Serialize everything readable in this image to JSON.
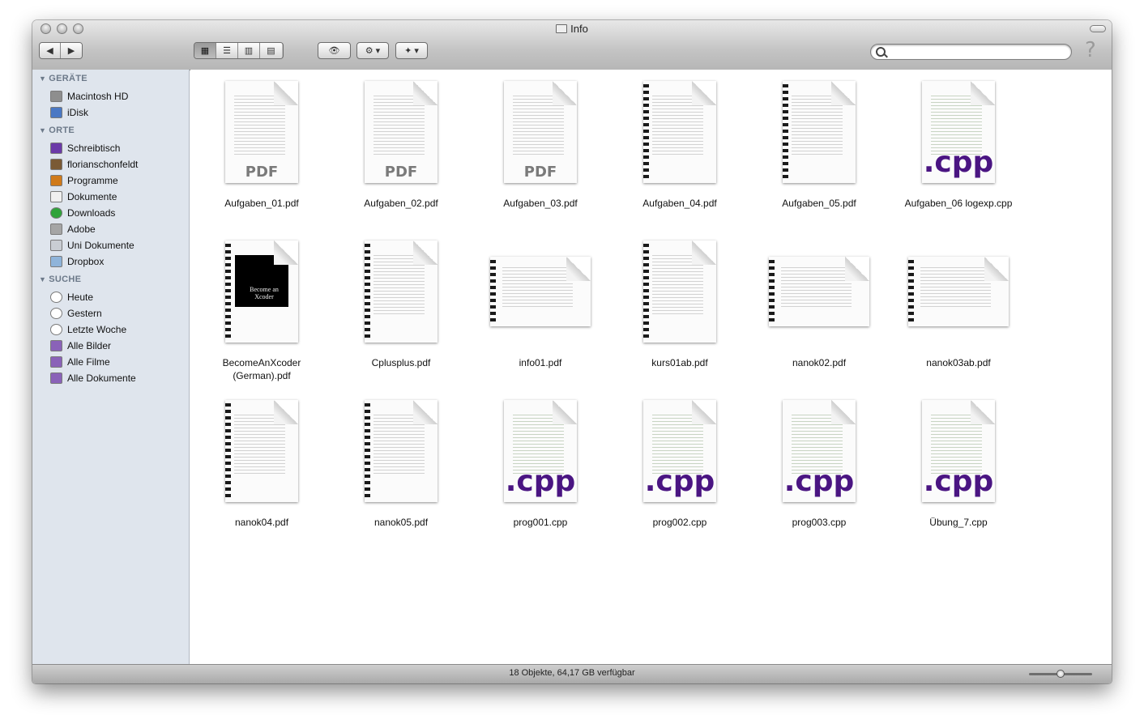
{
  "window": {
    "title": "Info"
  },
  "toolbar": {
    "back": "◀",
    "forward": "▶",
    "views": [
      {
        "name": "icon-view",
        "glyph": "▦",
        "active": true
      },
      {
        "name": "list-view",
        "glyph": "☰",
        "active": false
      },
      {
        "name": "column-view",
        "glyph": "▥",
        "active": false
      },
      {
        "name": "coverflow-view",
        "glyph": "▤",
        "active": false
      }
    ],
    "quicklook": "👁",
    "action": "⚙ ▾",
    "dropbox": "✦ ▾",
    "search_placeholder": "",
    "help": "?"
  },
  "sidebar": {
    "sections": [
      {
        "label": "GERÄTE",
        "items": [
          {
            "label": "Macintosh HD",
            "icon": "harddisk-icon",
            "color": "#8e8e8e"
          },
          {
            "label": "iDisk",
            "icon": "idisk-icon",
            "color": "#4a78c4"
          }
        ]
      },
      {
        "label": "ORTE",
        "items": [
          {
            "label": "Schreibtisch",
            "icon": "desktop-icon",
            "color": "#6b3aa8"
          },
          {
            "label": "florianschonfeldt",
            "icon": "home-icon",
            "color": "#7a5a35"
          },
          {
            "label": "Programme",
            "icon": "applications-icon",
            "color": "#d07a1a"
          },
          {
            "label": "Dokumente",
            "icon": "documents-icon",
            "color": "#f0f0f0"
          },
          {
            "label": "Downloads",
            "icon": "downloads-icon",
            "color": "#2fa33a"
          },
          {
            "label": "Adobe",
            "icon": "drive-icon",
            "color": "#a5a5a5"
          },
          {
            "label": "Uni Dokumente",
            "icon": "folder-icon",
            "color": "#c9cdd3"
          },
          {
            "label": "Dropbox",
            "icon": "folder-icon",
            "color": "#8fb4da"
          }
        ]
      },
      {
        "label": "SUCHE",
        "items": [
          {
            "label": "Heute",
            "icon": "clock-icon",
            "color": "#ffffff"
          },
          {
            "label": "Gestern",
            "icon": "clock-icon",
            "color": "#ffffff"
          },
          {
            "label": "Letzte Woche",
            "icon": "clock-icon",
            "color": "#ffffff"
          },
          {
            "label": "Alle Bilder",
            "icon": "smart-folder-icon",
            "color": "#8a62b8"
          },
          {
            "label": "Alle Filme",
            "icon": "smart-folder-icon",
            "color": "#8a62b8"
          },
          {
            "label": "Alle Dokumente",
            "icon": "smart-folder-icon",
            "color": "#8a62b8"
          }
        ]
      }
    ]
  },
  "files": [
    {
      "name": "Aufgaben_01.pdf",
      "kind": "pdf",
      "tag": "PDF"
    },
    {
      "name": "Aufgaben_02.pdf",
      "kind": "pdf",
      "tag": "PDF"
    },
    {
      "name": "Aufgaben_03.pdf",
      "kind": "pdf",
      "tag": "PDF"
    },
    {
      "name": "Aufgaben_04.pdf",
      "kind": "spiral",
      "tag": ""
    },
    {
      "name": "Aufgaben_05.pdf",
      "kind": "spiral",
      "tag": ""
    },
    {
      "name": "Aufgaben_06 logexp.cpp",
      "kind": "cpp",
      "tag": ".cpp"
    },
    {
      "name": "BecomeAnXcoder (German).pdf",
      "kind": "cover",
      "tag": "",
      "cover_text": "Become an Xcoder"
    },
    {
      "name": "Cplusplus.pdf",
      "kind": "spiral",
      "tag": ""
    },
    {
      "name": "info01.pdf",
      "kind": "landscape",
      "tag": ""
    },
    {
      "name": "kurs01ab.pdf",
      "kind": "spiral",
      "tag": ""
    },
    {
      "name": "nanok02.pdf",
      "kind": "landscape",
      "tag": ""
    },
    {
      "name": "nanok03ab.pdf",
      "kind": "landscape",
      "tag": ""
    },
    {
      "name": "nanok04.pdf",
      "kind": "spiral",
      "tag": ""
    },
    {
      "name": "nanok05.pdf",
      "kind": "spiral",
      "tag": ""
    },
    {
      "name": "prog001.cpp",
      "kind": "cpp",
      "tag": ".cpp"
    },
    {
      "name": "prog002.cpp",
      "kind": "cpp",
      "tag": ".cpp"
    },
    {
      "name": "prog003.cpp",
      "kind": "cpp",
      "tag": ".cpp"
    },
    {
      "name": "Übung_7.cpp",
      "kind": "cpp",
      "tag": ".cpp"
    }
  ],
  "colors": {
    "cpp": "#4a1582",
    "pdf": "#7a7a7a"
  },
  "status": {
    "text": "18 Objekte, 64,17 GB verfügbar",
    "zoom": 0.5
  }
}
